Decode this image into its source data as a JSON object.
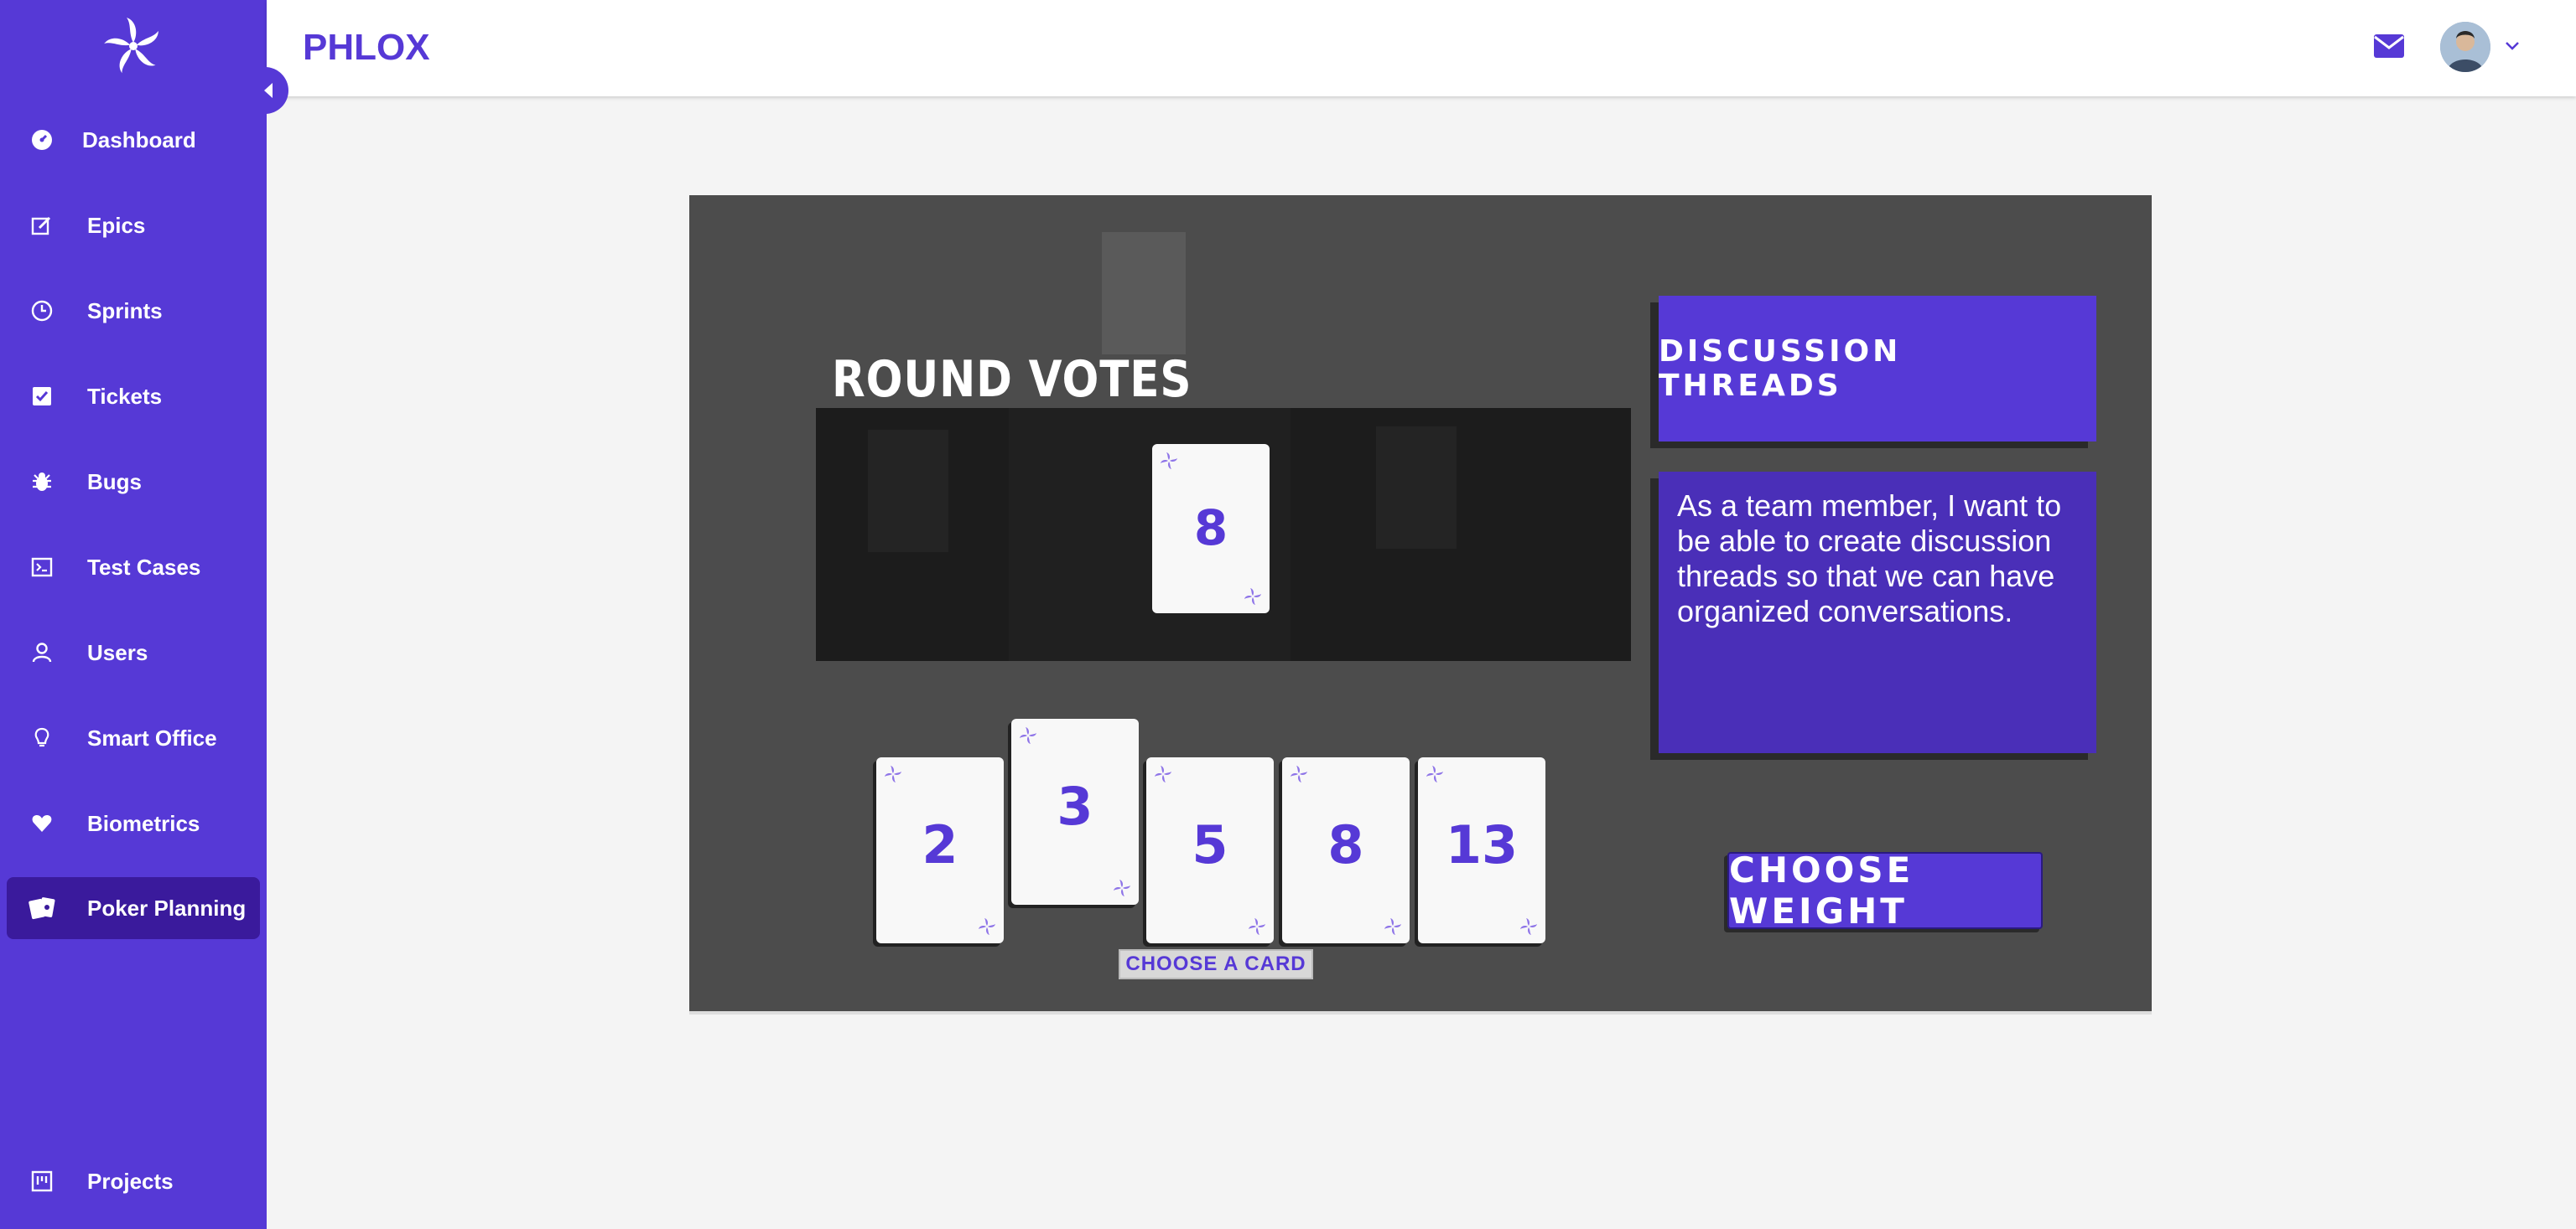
{
  "app": {
    "title": "PHLOX"
  },
  "sidebar": {
    "items": [
      {
        "label": "Dashboard",
        "icon": "dashboard-icon"
      },
      {
        "label": "Epics",
        "icon": "edit-icon"
      },
      {
        "label": "Sprints",
        "icon": "clock-icon"
      },
      {
        "label": "Tickets",
        "icon": "check-square-icon"
      },
      {
        "label": "Bugs",
        "icon": "bug-icon"
      },
      {
        "label": "Test Cases",
        "icon": "terminal-icon"
      },
      {
        "label": "Users",
        "icon": "user-icon"
      },
      {
        "label": "Smart Office",
        "icon": "lightbulb-icon"
      },
      {
        "label": "Biometrics",
        "icon": "heart-icon"
      },
      {
        "label": "Poker Planning",
        "icon": "cards-icon",
        "active": true
      },
      {
        "label": "Projects",
        "icon": "board-icon"
      }
    ]
  },
  "game": {
    "round_title": "ROUND VOTES",
    "voted_card": "8",
    "hand": [
      "2",
      "3",
      "5",
      "8",
      "13"
    ],
    "choose_card_label": "CHOOSE A CARD",
    "discussion_label": "DISCUSSION THREADS",
    "story_text": "As a team member, I want to be able to create discussion threads so that we can have organized conversations.",
    "choose_weight_label": "CHOOSE WEIGHT"
  },
  "colors": {
    "brand": "#5639d6",
    "sidebar_active": "#3a1a9c",
    "game_bg": "#4c4c4c",
    "votes_bg": "#1c1c1c"
  }
}
